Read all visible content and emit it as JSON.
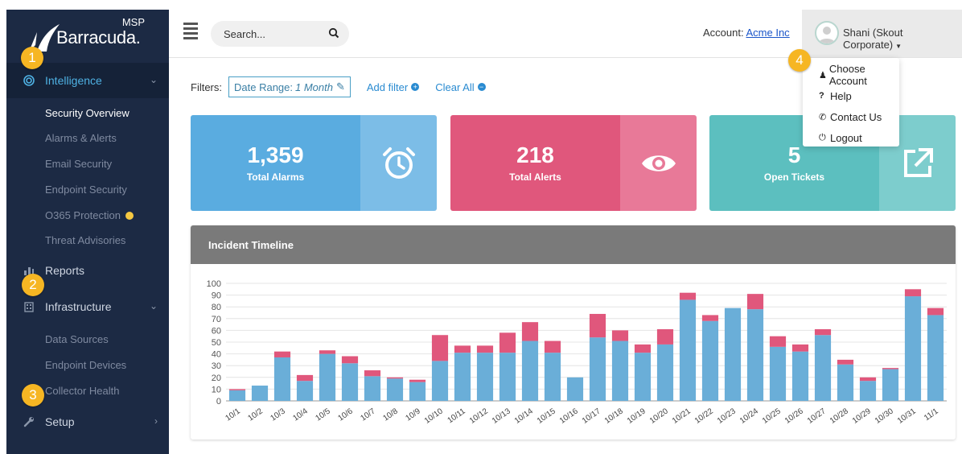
{
  "brand": {
    "msp": "MSP",
    "name": "Barracuda."
  },
  "sidebar": {
    "items": [
      {
        "label": "Intelligence",
        "icon": "target-icon"
      },
      {
        "label": "Reports",
        "icon": "bar-chart-icon"
      },
      {
        "label": "Infrastructure",
        "icon": "building-icon"
      },
      {
        "label": "Setup",
        "icon": "wrench-icon"
      }
    ],
    "intelligence_sub": [
      "Security Overview",
      "Alarms & Alerts",
      "Email Security",
      "Endpoint Security",
      "O365 Protection",
      "Threat Advisories"
    ],
    "infrastructure_sub": [
      "Data Sources",
      "Endpoint Devices",
      "Collector Health"
    ]
  },
  "markers": [
    "1",
    "2",
    "3",
    "4"
  ],
  "search": {
    "placeholder": "Search..."
  },
  "account": {
    "label": "Account:",
    "value": "Acme Inc"
  },
  "user": {
    "name": "Shani (Skout Corporate)"
  },
  "dropdown": {
    "items": [
      "Choose Account",
      "Help",
      "Contact Us",
      "Logout"
    ]
  },
  "filters": {
    "label": "Filters:",
    "chip_label": "Date Range:",
    "chip_value": "1 Month",
    "add": "Add filter",
    "clear": "Clear All"
  },
  "cards": [
    {
      "value": "1,359",
      "label": "Total Alarms",
      "color": "#5aace0",
      "side_color": "#7cbde7",
      "icon": "alarm-clock-icon"
    },
    {
      "value": "218",
      "label": "Total Alerts",
      "color": "#e0577c",
      "side_color": "#e87998",
      "icon": "eye-icon"
    },
    {
      "value": "5",
      "label": "Open Tickets",
      "color": "#5cbfbf",
      "side_color": "#7dcdcd",
      "icon": "external-link-icon"
    }
  ],
  "chart_data": {
    "type": "bar",
    "title": "Incident Timeline",
    "categories": [
      "10/1",
      "10/2",
      "10/3",
      "10/4",
      "10/5",
      "10/6",
      "10/7",
      "10/8",
      "10/9",
      "10/10",
      "10/11",
      "10/12",
      "10/13",
      "10/14",
      "10/15",
      "10/16",
      "10/17",
      "10/18",
      "10/19",
      "10/20",
      "10/21",
      "10/22",
      "10/23",
      "10/24",
      "10/25",
      "10/26",
      "10/27",
      "10/28",
      "10/29",
      "10/30",
      "10/31",
      "11/1"
    ],
    "series": [
      {
        "color": "#6aaed8",
        "values": [
          9,
          13,
          37,
          17,
          40,
          32,
          21,
          19,
          16,
          34,
          41,
          41,
          41,
          51,
          41,
          20,
          54,
          51,
          41,
          48,
          86,
          68,
          79,
          78,
          46,
          42,
          56,
          31,
          17,
          27,
          89,
          73
        ]
      },
      {
        "color": "#e0577c",
        "values": [
          1,
          0,
          5,
          5,
          3,
          6,
          5,
          1,
          2,
          22,
          6,
          6,
          17,
          16,
          10,
          0,
          20,
          9,
          7,
          13,
          6,
          5,
          0,
          13,
          9,
          6,
          5,
          4,
          3,
          1,
          6,
          6
        ]
      }
    ],
    "stacked": true,
    "ylim": [
      0,
      100
    ],
    "yticks": [
      0,
      10,
      20,
      30,
      40,
      50,
      60,
      70,
      80,
      90,
      100
    ],
    "grid": true
  }
}
